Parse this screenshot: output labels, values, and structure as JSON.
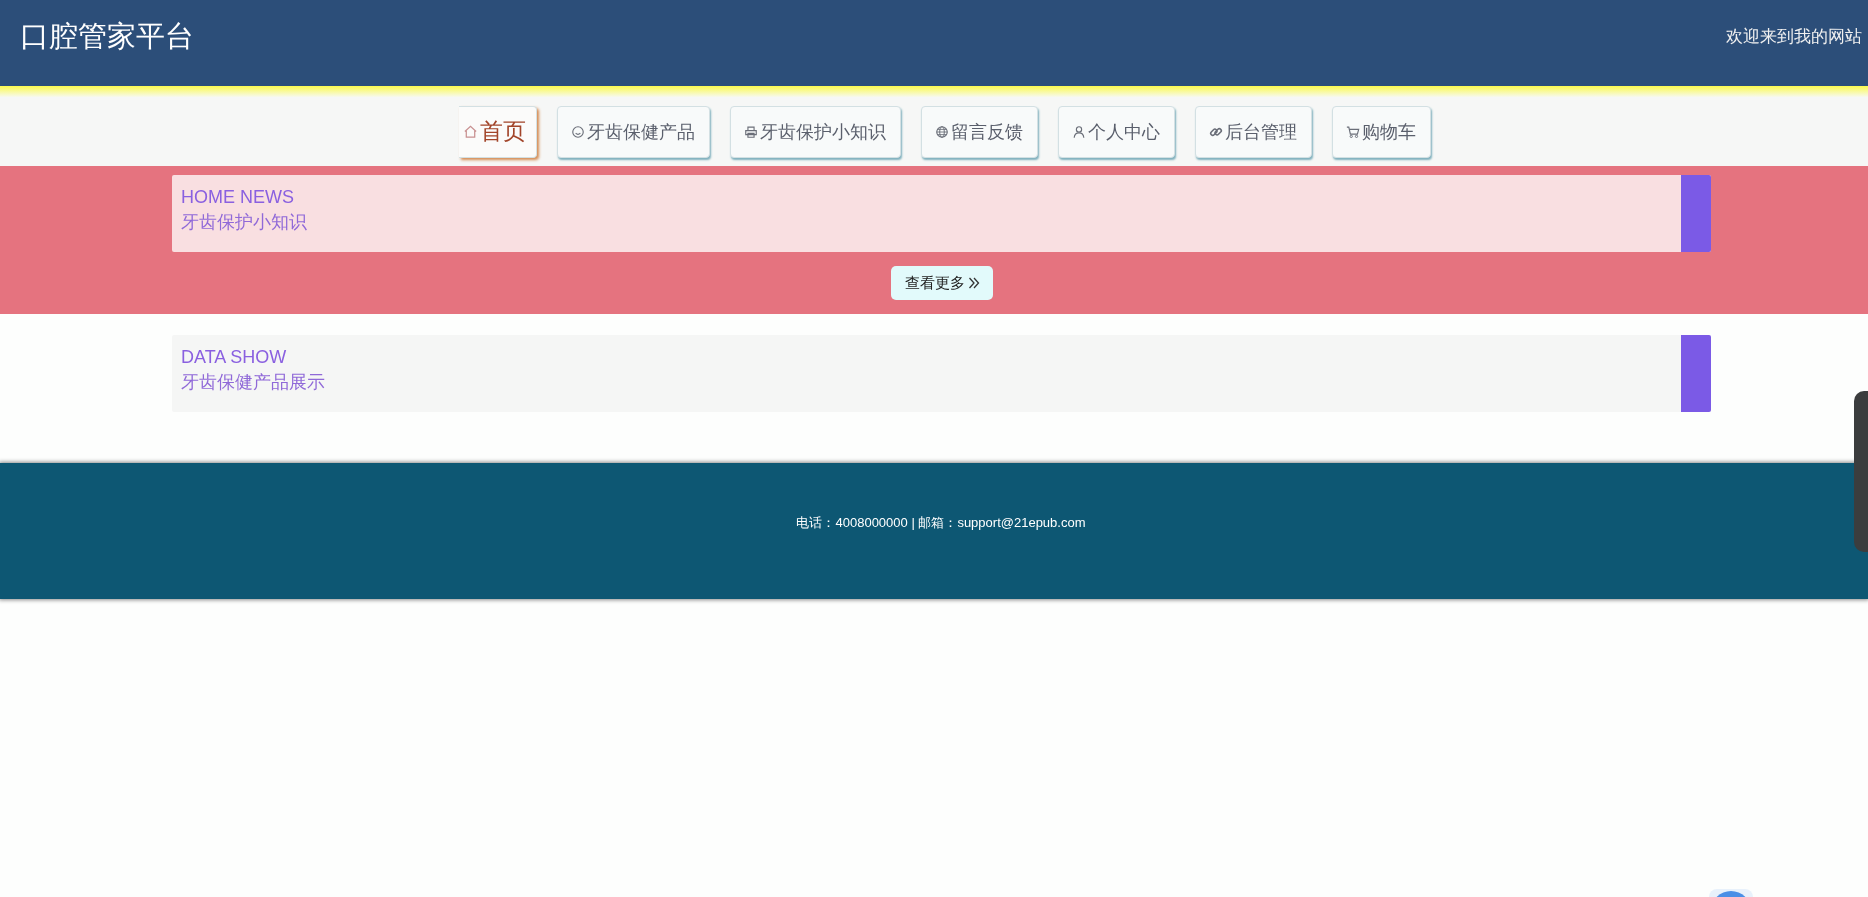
{
  "header": {
    "title": "口腔管家平台",
    "welcome": "欢迎来到我的网站"
  },
  "nav": [
    {
      "label": "首页",
      "selected": true
    },
    {
      "label": "牙齿保健产品",
      "selected": false
    },
    {
      "label": "牙齿保护小知识",
      "selected": false
    },
    {
      "label": "留言反馈",
      "selected": false
    },
    {
      "label": "个人中心",
      "selected": false
    },
    {
      "label": "后台管理",
      "selected": false
    },
    {
      "label": "购物车",
      "selected": false
    }
  ],
  "sections": [
    {
      "kind": "band",
      "title": "HOME NEWS",
      "subtitle": "牙齿保护小知识",
      "more_button": "查看更多"
    },
    {
      "kind": "plain",
      "title": "DATA SHOW",
      "subtitle": "牙齿保健产品展示"
    }
  ],
  "footer": {
    "contact": "电话：4008000000 | 邮箱：support@21epub.com"
  }
}
